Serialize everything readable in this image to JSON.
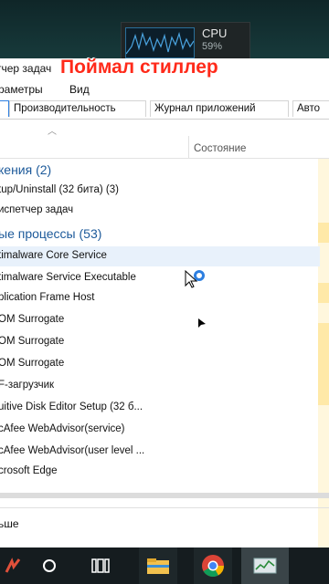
{
  "desktop": {
    "cpu_label": "CPU",
    "cpu_value": "59%"
  },
  "window": {
    "title": "тчер задач",
    "overlay_caption": "Поймал стиллер",
    "menu": [
      "раметры",
      "Вид"
    ],
    "tabs": [
      "Производительность",
      "Журнал приложений",
      "Авто"
    ],
    "column_status": "Состояние"
  },
  "rows": [
    {
      "text": "кения (2)",
      "group": true
    },
    {
      "text": "tup/Uninstall (32 бита) (3)"
    },
    {
      "text": "испетчер задач"
    },
    {
      "text": "ые процессы (53)",
      "group": true
    },
    {
      "text": "timalware Core Service",
      "selected": true
    },
    {
      "text": "timalware Service Executable"
    },
    {
      "text": "plication Frame Host"
    },
    {
      "text": "OM Surrogate"
    },
    {
      "text": "OM Surrogate"
    },
    {
      "text": "OM Surrogate"
    },
    {
      "text": "F-загрузчик"
    },
    {
      "text": "uitive Disk Editor Setup (32 б..."
    },
    {
      "text": "cAfee WebAdvisor(service)"
    },
    {
      "text": "cAfee WebAdvisor(user level ..."
    },
    {
      "text": "crosoft Edge"
    }
  ],
  "bottom": {
    "link": "ьше"
  },
  "taskbar": {
    "icons": [
      "start-icon",
      "search-circle-icon",
      "task-view-icon",
      "file-explorer-icon",
      "chrome-icon",
      "task-manager-icon"
    ]
  }
}
